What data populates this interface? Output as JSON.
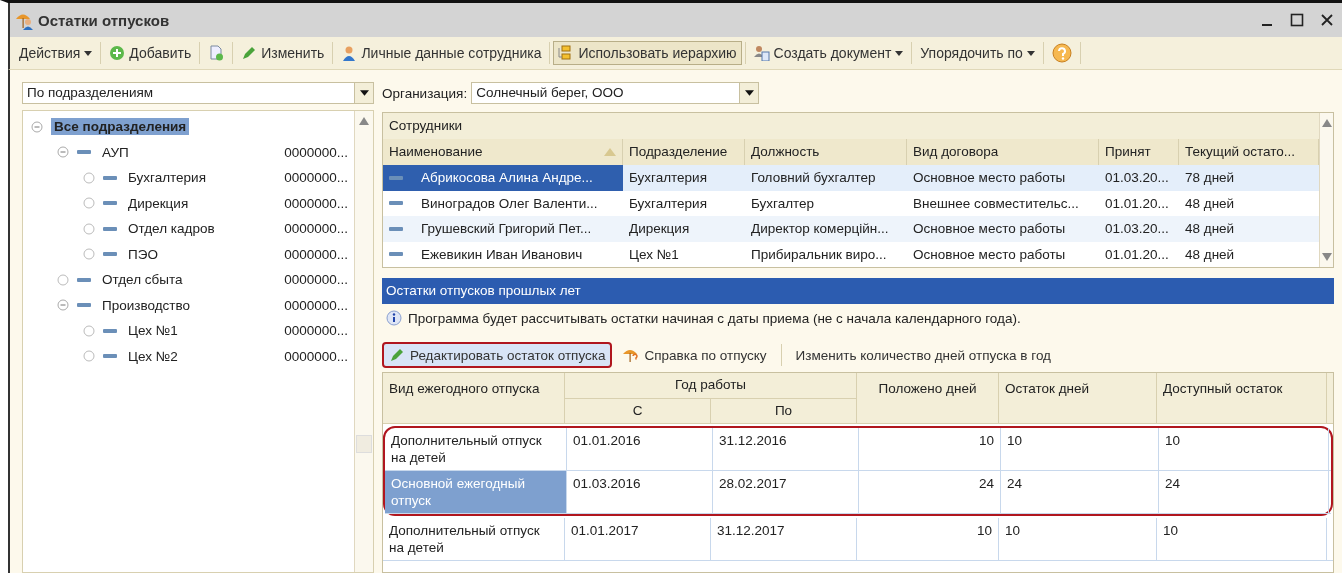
{
  "window": {
    "title": "Остатки отпусков"
  },
  "toolbar": [
    {
      "label": "Действия",
      "kind": "menu"
    },
    {
      "label": "Добавить",
      "kind": "add"
    },
    {
      "kind": "copy"
    },
    {
      "label": "Изменить",
      "kind": "edit"
    },
    {
      "label": "Личные данные сотрудника",
      "kind": "person"
    },
    {
      "label": "Использовать иерархию",
      "kind": "hierarchy",
      "selected": true
    },
    {
      "label": "Создать документ",
      "kind": "document"
    },
    {
      "label": "Упорядочить по",
      "kind": "menu"
    },
    {
      "kind": "help"
    }
  ],
  "grouping": {
    "value": "По подразделениям"
  },
  "organization": {
    "label": "Организация:",
    "value": "Солнечный берег, ООО"
  },
  "tree": [
    {
      "name": "Все подразделения",
      "selected": true,
      "expanded": true,
      "children": [
        {
          "name": "АУП",
          "code": "0000000...",
          "selected": false,
          "expanded": true,
          "children": [
            {
              "name": "Бухгалтерия",
              "code": "0000000...",
              "selected": false,
              "expanded": false
            },
            {
              "name": "Дирекция",
              "code": "0000000...",
              "selected": false,
              "expanded": false
            },
            {
              "name": "Отдел кадров",
              "code": "0000000...",
              "selected": false,
              "expanded": false
            },
            {
              "name": "ПЭО",
              "code": "0000000...",
              "selected": false,
              "expanded": false
            }
          ]
        },
        {
          "name": "Отдел сбыта",
          "code": "0000000...",
          "selected": false,
          "expanded": false
        },
        {
          "name": "Производство",
          "code": "0000000...",
          "selected": false,
          "expanded": true,
          "children": [
            {
              "name": "Цех №1",
              "code": "0000000...",
              "selected": false,
              "expanded": false
            },
            {
              "name": "Цех №2",
              "code": "0000000...",
              "selected": false,
              "expanded": false
            }
          ]
        }
      ]
    }
  ],
  "employees": {
    "title": "Сотрудники",
    "columns": [
      "Наименование",
      "Подразделение",
      "Должность",
      "Вид договора",
      "Принят",
      "Текущий остато..."
    ],
    "rows": [
      {
        "cells": [
          "Абрикосова Алина Андре...",
          "Бухгалтерия",
          "Головний бухгалтер",
          "Основное место работы",
          "01.03.20...",
          "78  дней"
        ],
        "selected": true
      },
      {
        "cells": [
          "Виноградов Олег Валенти...",
          "Бухгалтерия",
          "Бухгалтер",
          "Внешнее совместительс...",
          "01.01.20...",
          "48  дней"
        ],
        "selected": false
      },
      {
        "cells": [
          "Грушевский Григорий Пет...",
          "Дирекция",
          "Директор комерційн...",
          "Основное место работы",
          "01.03.20...",
          "48  дней"
        ],
        "selected": false
      },
      {
        "cells": [
          "Ежевикин Иван Иванович",
          "Цех №1",
          "Прибиральник виро...",
          "Основное место работы",
          "01.01.20...",
          "48  дней"
        ],
        "selected": false
      }
    ]
  },
  "past": {
    "title": "Остатки отпусков прошлых лет",
    "info": "Программа будет рассчитывать остатки начиная с даты приема (не с начала календарного года).",
    "actions": [
      {
        "label": "Редактировать остаток отпуска",
        "kind": "edit",
        "highlighted": true
      },
      {
        "label": "Справка по отпуску",
        "kind": "report",
        "highlighted": false
      },
      {
        "label": "Изменить количество дней отпуска в год",
        "kind": "plain",
        "highlighted": false
      }
    ],
    "columns": {
      "kind": "Вид ежегодного отпуска",
      "year": "Год работы",
      "from": "С",
      "to": "По",
      "norm": "Положено дней",
      "rest": "Остаток дней",
      "avail": "Доступный остаток"
    },
    "rows": [
      {
        "cells": [
          "Дополнительный отпуск на детей",
          "01.01.2016",
          "31.12.2016",
          "10",
          "10",
          "10"
        ],
        "selected": false,
        "highlighted": true
      },
      {
        "cells": [
          "Основной ежегодный отпуск",
          "01.03.2016",
          "28.02.2017",
          "24",
          "24",
          "24"
        ],
        "selected": true,
        "highlighted": true
      },
      {
        "cells": [
          "Дополнительный отпуск на детей",
          "01.01.2017",
          "31.12.2017",
          "10",
          "10",
          "10"
        ],
        "selected": false,
        "highlighted": false
      }
    ]
  }
}
